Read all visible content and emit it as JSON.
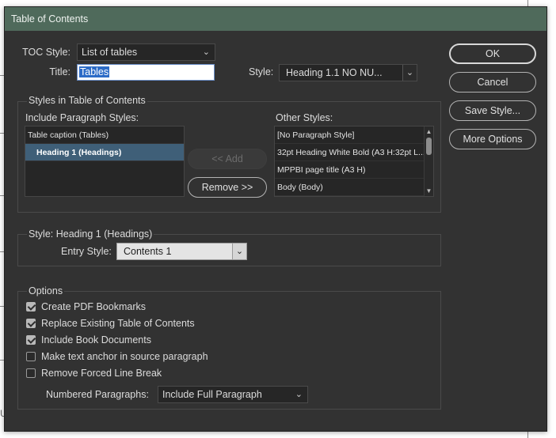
{
  "window": {
    "title": "Table of Contents"
  },
  "toc_style": {
    "label": "TOC Style:",
    "value": "List of tables"
  },
  "title_field": {
    "label": "Title:",
    "value": "Tables"
  },
  "title_style": {
    "label": "Style:",
    "value": "Heading 1.1 NO NU..."
  },
  "styles_group": {
    "title": "Styles in Table of Contents",
    "include_label": "Include Paragraph Styles:",
    "include_items": [
      "Table caption (Tables)",
      "Heading 1 (Headings)"
    ],
    "other_label": "Other Styles:",
    "other_items": [
      "[No Paragraph Style]",
      "32pt Heading White Bold (A3 H:32pt L...",
      "MPPBI page title (A3 H)",
      "Body (Body)"
    ],
    "add_button": "<< Add",
    "remove_button": "Remove >>"
  },
  "style_group": {
    "title": "Style: Heading 1 (Headings)",
    "entry_style_label": "Entry Style:",
    "entry_style_value": "Contents 1"
  },
  "options_group": {
    "title": "Options",
    "checkboxes": [
      {
        "label": "Create PDF Bookmarks",
        "checked": true
      },
      {
        "label": "Replace Existing Table of Contents",
        "checked": true
      },
      {
        "label": "Include Book Documents",
        "checked": true
      },
      {
        "label": "Make text anchor in source paragraph",
        "checked": false
      },
      {
        "label": "Remove Forced Line Break",
        "checked": false
      }
    ],
    "numbered_label": "Numbered Paragraphs:",
    "numbered_value": "Include Full Paragraph"
  },
  "buttons": {
    "ok": "OK",
    "cancel": "Cancel",
    "save_style": "Save Style...",
    "more_options": "More Options"
  },
  "background": {
    "edge_char": "U"
  },
  "colors": {
    "titlebar": "#4f6a5b",
    "dialog_bg": "#323232",
    "selection": "#3f5f78",
    "title_highlight": "#2d6cc7"
  },
  "icons": {
    "dropdown": "chevron-down-icon",
    "scroll_up": "chevron-up-icon",
    "scroll_down": "chevron-down-icon",
    "checkbox": "checkmark-icon"
  }
}
